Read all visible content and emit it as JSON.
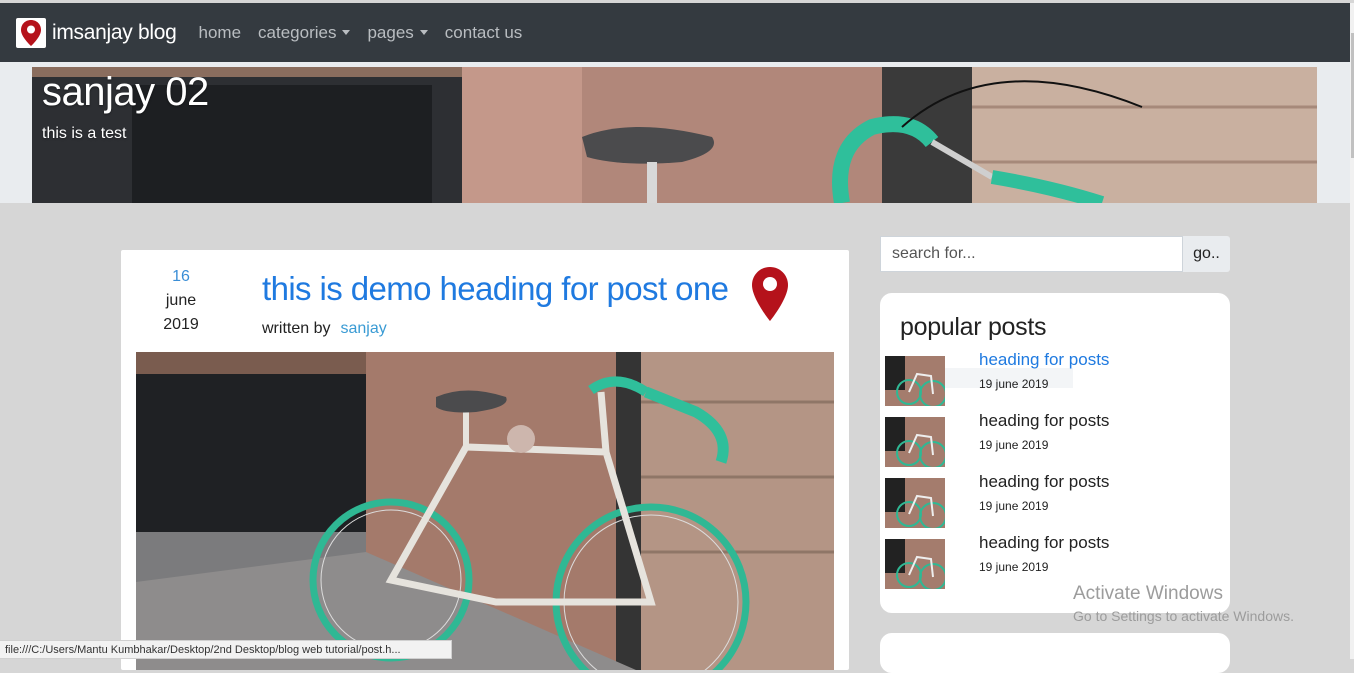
{
  "navbar": {
    "brand": "imsanjay blog",
    "links": [
      {
        "label": "home",
        "dropdown": false
      },
      {
        "label": "categories",
        "dropdown": true
      },
      {
        "label": "pages",
        "dropdown": true
      },
      {
        "label": "contact us",
        "dropdown": false
      }
    ]
  },
  "hero": {
    "title": "sanjay 02",
    "subtitle": "this is a test"
  },
  "post": {
    "day": "16",
    "month": "june",
    "year": "2019",
    "title": "this is demo heading for post one",
    "written_by": "written by",
    "author": "sanjay"
  },
  "search": {
    "placeholder": "search for...",
    "button": "go.."
  },
  "popular": {
    "title": "popular posts",
    "items": [
      {
        "heading": "heading for posts",
        "date": "19 june 2019"
      },
      {
        "heading": "heading for posts",
        "date": "19 june 2019"
      },
      {
        "heading": "heading for posts",
        "date": "19 june 2019"
      },
      {
        "heading": "heading for posts",
        "date": "19 june 2019"
      }
    ]
  },
  "windows": {
    "title": "Activate Windows",
    "subtitle": "Go to Settings to activate Windows."
  },
  "statusbar": {
    "url": "file:///C:/Users/Mantu Kumbhakar/Desktop/2nd Desktop/blog web tutorial/post.h..."
  },
  "colors": {
    "navbar": "#343a40",
    "accent": "#1f7ae0",
    "pin": "#b5121b",
    "page_bg": "#d6d6d6"
  }
}
